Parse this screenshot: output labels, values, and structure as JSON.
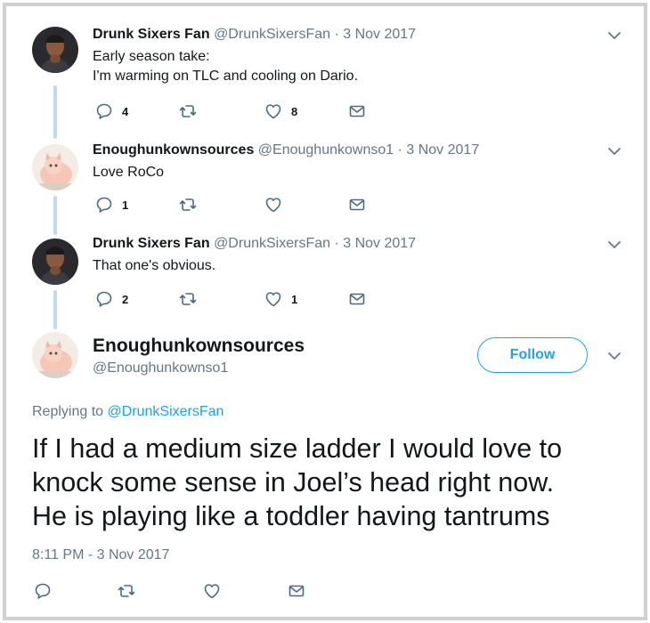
{
  "tweets": [
    {
      "name": "Drunk Sixers Fan",
      "handle": "@DrunkSixersFan",
      "date": "3 Nov 2017",
      "lines": [
        "Early season take:",
        "I'm warming on TLC and cooling on Dario."
      ],
      "replies": "4",
      "retweets": "",
      "likes": "8"
    },
    {
      "name": "Enoughunkownsources",
      "handle": "@Enoughunkownso1",
      "date": "3 Nov 2017",
      "lines": [
        "Love RoCo"
      ],
      "replies": "1",
      "retweets": "",
      "likes": ""
    },
    {
      "name": "Drunk Sixers Fan",
      "handle": "@DrunkSixersFan",
      "date": "3 Nov 2017",
      "lines": [
        "That one's obvious."
      ],
      "replies": "2",
      "retweets": "",
      "likes": "1"
    }
  ],
  "main": {
    "name": "Enoughunkownsources",
    "handle": "@Enoughunkownso1",
    "follow_label": "Follow",
    "replying_prefix": "Replying to ",
    "replying_to": "@DrunkSixersFan",
    "lines": [
      "If I had a medium size ladder I would love to",
      "knock some sense in Joel’s head right now.",
      "He is playing like a toddler having tantrums"
    ],
    "timestamp": "8:11 PM - 3 Nov 2017"
  },
  "separator": " · ",
  "colors": {
    "accent": "#1da1f2",
    "thread_line": "#b9dcf4",
    "secondary_text": "#657786",
    "icon": "#4a6a82"
  },
  "icons": [
    "reply-icon",
    "retweet-icon",
    "like-icon",
    "message-icon",
    "chevron-down-icon"
  ]
}
